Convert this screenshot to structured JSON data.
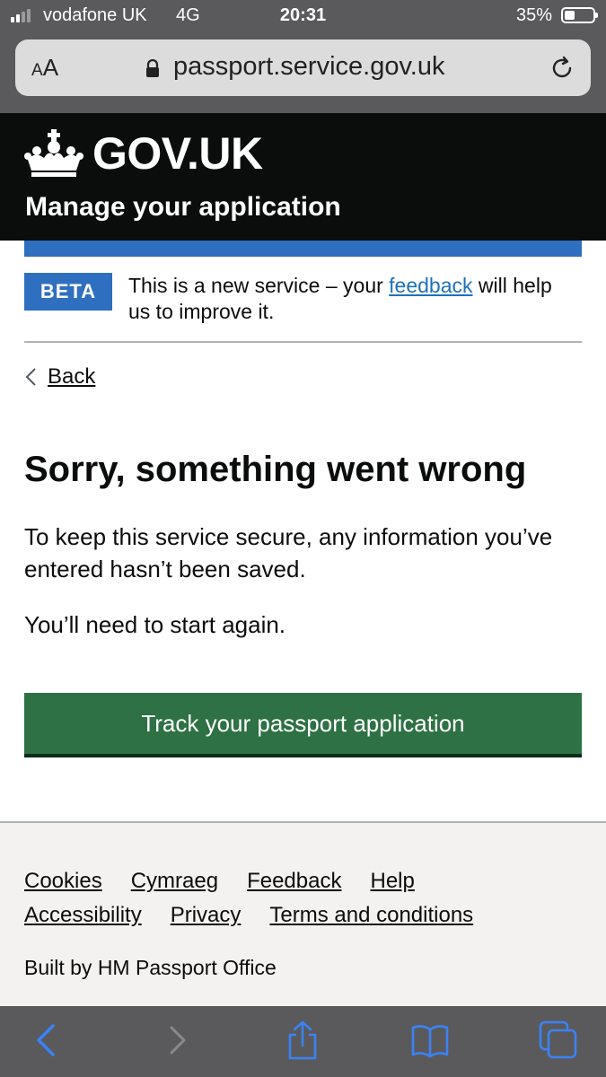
{
  "status_bar": {
    "carrier": "vodafone UK",
    "network": "4G",
    "time": "20:31",
    "battery_percent": "35%",
    "battery_level": 0.35
  },
  "browser": {
    "text_size_label_small": "A",
    "text_size_label_large": "A",
    "url": "passport.service.gov.uk"
  },
  "header": {
    "logo_text": "GOV.UK",
    "service_name": "Manage your application"
  },
  "phase_banner": {
    "tag": "BETA",
    "text_before": "This is a new service – your ",
    "link_text": "feedback",
    "text_after": " will help us to improve it."
  },
  "back_link": "Back",
  "main": {
    "heading": "Sorry, something went wrong",
    "paragraph_1": "To keep this service secure, any information you’ve entered hasn’t been saved.",
    "paragraph_2": "You’ll need to start again.",
    "button_label": "Track your passport application"
  },
  "footer": {
    "links_row_1": [
      "Cookies",
      "Cymraeg",
      "Feedback",
      "Help"
    ],
    "links_row_2": [
      "Accessibility",
      "Privacy",
      "Terms and conditions"
    ],
    "built_by": "Built by HM Passport Office"
  },
  "colors": {
    "header_bg": "#0b0c0c",
    "beta_blue": "#2f6fbf",
    "link_blue": "#1d70b8",
    "button_green": "#2e7144",
    "footer_bg": "#f3f2f1",
    "ios_blue": "#3b82f6"
  },
  "toolbar_icons": [
    "back-icon",
    "forward-icon",
    "share-icon",
    "bookmarks-icon",
    "tabs-icon"
  ]
}
